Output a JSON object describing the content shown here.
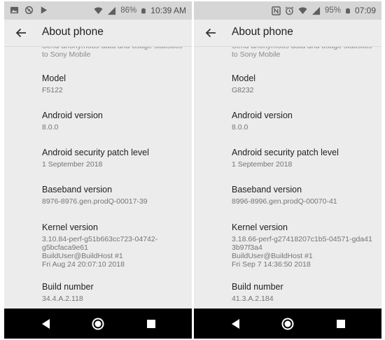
{
  "phones": [
    {
      "status": {
        "battery": "86%",
        "time": "10:39 AM"
      },
      "app_bar": {
        "title": "About phone"
      },
      "partial_text": "Send anonymous data and usage statistics\nto Sony Mobile",
      "prefs": [
        {
          "title": "Model",
          "summary": "F5122"
        },
        {
          "title": "Android version",
          "summary": "8.0.0"
        },
        {
          "title": "Android security patch level",
          "summary": "1 September 2018"
        },
        {
          "title": "Baseband version",
          "summary": "8976-8976.gen.prodQ-00017-39"
        },
        {
          "title": "Kernel version",
          "summary": "3.10.84-perf-g51b663cc723-04742-\ng5bcfaca9e61\nBuildUser@BuildHost #1\nFri Aug 24 20:07:10 2018"
        },
        {
          "title": "Build number",
          "summary": "34.4.A.2.118"
        }
      ]
    },
    {
      "status": {
        "battery": "95%",
        "time": "07:09"
      },
      "app_bar": {
        "title": "About phone"
      },
      "partial_text": "Send anonymous data and usage statistics\nto Sony Mobile",
      "prefs": [
        {
          "title": "Model",
          "summary": "G8232"
        },
        {
          "title": "Android version",
          "summary": "8.0.0"
        },
        {
          "title": "Android security patch level",
          "summary": "1 September 2018"
        },
        {
          "title": "Baseband version",
          "summary": "8996-8996.gen.prodQ-00070-41"
        },
        {
          "title": "Kernel version",
          "summary": "3.18.66-perf-g27418207c1b5-04571-gda41\n3b97f3a4\nBuildUser@BuildHost #1\nFri Sep 7 14:36:50 2018"
        },
        {
          "title": "Build number",
          "summary": "41.3.A.2.184"
        }
      ]
    }
  ],
  "icons": {
    "left_status": [
      "image-icon",
      "no-sync-icon",
      "play-store-icon",
      "wifi-icon",
      "signal-icon"
    ],
    "right_status": [
      "nfc-icon",
      "alarm-icon",
      "wifi-icon",
      "signal-icon"
    ],
    "app_bar": [
      "back-arrow-icon"
    ],
    "navigation": [
      "nav-back-icon",
      "nav-home-icon",
      "nav-recents-icon"
    ]
  },
  "colors": {
    "status_bar": "#d6d6d6",
    "background": "#ececec",
    "nav_bar": "#000000",
    "title_text": "#202020",
    "summary_text": "#747474"
  }
}
